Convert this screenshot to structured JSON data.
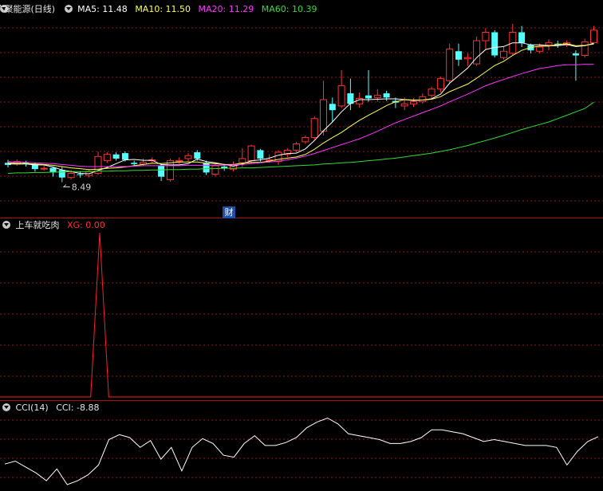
{
  "header": {
    "title": "广聚能源(日线)",
    "ma5": "MA5: 11.48",
    "ma10": "MA10: 11.50",
    "ma20": "MA20: 11.29",
    "ma60": "MA60: 10.39"
  },
  "panel2": {
    "title": "上车就吃肉",
    "xg": "XG: 0.00"
  },
  "panel3": {
    "title": "CCI(14)",
    "cci": "CCI: -8.88"
  },
  "annotations": {
    "low_price": "8.49",
    "cai_badge": "财"
  },
  "colors": {
    "up": "#ff3232",
    "down": "#54ffff",
    "ma5": "#ffffff",
    "ma10": "#ffff55",
    "ma20": "#ff33ff",
    "ma60": "#33dd33",
    "grid": "#8a1a1a",
    "signal": "#ff2020",
    "cci": "#ffffff"
  },
  "chart_data": [
    {
      "type": "candlestick",
      "y_unit": "price",
      "ylim": [
        7.8,
        12.4
      ],
      "candles": [
        {
          "o": 8.95,
          "c": 8.9,
          "h": 9.02,
          "l": 8.84
        },
        {
          "o": 8.92,
          "c": 8.98,
          "h": 9.03,
          "l": 8.88
        },
        {
          "o": 8.96,
          "c": 8.93,
          "h": 9.0,
          "l": 8.86
        },
        {
          "o": 8.92,
          "c": 8.8,
          "h": 8.96,
          "l": 8.74
        },
        {
          "o": 8.8,
          "c": 8.82,
          "h": 8.9,
          "l": 8.76
        },
        {
          "o": 8.83,
          "c": 8.72,
          "h": 8.86,
          "l": 8.62
        },
        {
          "o": 8.78,
          "c": 8.6,
          "h": 8.85,
          "l": 8.49
        },
        {
          "o": 8.6,
          "c": 8.7,
          "h": 8.78,
          "l": 8.55
        },
        {
          "o": 8.68,
          "c": 8.66,
          "h": 8.75,
          "l": 8.6
        },
        {
          "o": 8.65,
          "c": 8.75,
          "h": 8.8,
          "l": 8.6
        },
        {
          "o": 8.7,
          "c": 9.1,
          "h": 9.22,
          "l": 8.66
        },
        {
          "o": 9.0,
          "c": 9.15,
          "h": 9.2,
          "l": 8.95
        },
        {
          "o": 9.15,
          "c": 9.05,
          "h": 9.2,
          "l": 9.0
        },
        {
          "o": 9.18,
          "c": 9.02,
          "h": 9.22,
          "l": 8.98
        },
        {
          "o": 8.95,
          "c": 8.92,
          "h": 9.0,
          "l": 8.86
        },
        {
          "o": 8.92,
          "c": 8.96,
          "h": 9.05,
          "l": 8.88
        },
        {
          "o": 9.0,
          "c": 9.02,
          "h": 9.08,
          "l": 8.95
        },
        {
          "o": 8.88,
          "c": 8.62,
          "h": 8.92,
          "l": 8.52
        },
        {
          "o": 8.55,
          "c": 9.0,
          "h": 9.05,
          "l": 8.5
        },
        {
          "o": 8.98,
          "c": 9.0,
          "h": 9.08,
          "l": 8.92
        },
        {
          "o": 9.05,
          "c": 9.12,
          "h": 9.18,
          "l": 8.98
        },
        {
          "o": 9.2,
          "c": 9.05,
          "h": 9.25,
          "l": 9.0
        },
        {
          "o": 8.95,
          "c": 8.72,
          "h": 9.0,
          "l": 8.66
        },
        {
          "o": 8.68,
          "c": 8.88,
          "h": 8.95,
          "l": 8.62
        },
        {
          "o": 8.86,
          "c": 8.82,
          "h": 8.92,
          "l": 8.76
        },
        {
          "o": 8.8,
          "c": 8.9,
          "h": 8.98,
          "l": 8.75
        },
        {
          "o": 8.95,
          "c": 9.05,
          "h": 9.3,
          "l": 8.85
        },
        {
          "o": 9.0,
          "c": 9.35,
          "h": 9.38,
          "l": 8.94
        },
        {
          "o": 9.25,
          "c": 9.05,
          "h": 9.28,
          "l": 8.98
        },
        {
          "o": 9.0,
          "c": 9.02,
          "h": 9.15,
          "l": 8.95
        },
        {
          "o": 8.98,
          "c": 9.2,
          "h": 9.25,
          "l": 8.9
        },
        {
          "o": 9.15,
          "c": 9.25,
          "h": 9.3,
          "l": 9.08
        },
        {
          "o": 9.25,
          "c": 9.4,
          "h": 9.45,
          "l": 9.2
        },
        {
          "o": 9.45,
          "c": 9.55,
          "h": 9.6,
          "l": 9.4
        },
        {
          "o": 9.55,
          "c": 10.0,
          "h": 10.05,
          "l": 9.5
        },
        {
          "o": 9.7,
          "c": 10.45,
          "h": 10.9,
          "l": 9.6
        },
        {
          "o": 10.35,
          "c": 10.2,
          "h": 10.5,
          "l": 9.92
        },
        {
          "o": 10.3,
          "c": 10.78,
          "h": 11.15,
          "l": 10.25
        },
        {
          "o": 10.6,
          "c": 10.35,
          "h": 10.95,
          "l": 10.2
        },
        {
          "o": 10.35,
          "c": 10.48,
          "h": 10.62,
          "l": 10.26
        },
        {
          "o": 10.55,
          "c": 10.48,
          "h": 11.15,
          "l": 10.4
        },
        {
          "o": 10.5,
          "c": 10.55,
          "h": 10.7,
          "l": 10.4
        },
        {
          "o": 10.6,
          "c": 10.5,
          "h": 10.66,
          "l": 10.42
        },
        {
          "o": 10.42,
          "c": 10.38,
          "h": 10.5,
          "l": 10.25
        },
        {
          "o": 10.3,
          "c": 10.35,
          "h": 10.5,
          "l": 10.2
        },
        {
          "o": 10.35,
          "c": 10.4,
          "h": 10.48,
          "l": 10.28
        },
        {
          "o": 10.4,
          "c": 10.52,
          "h": 10.6,
          "l": 10.35
        },
        {
          "o": 10.55,
          "c": 10.7,
          "h": 10.76,
          "l": 10.48
        },
        {
          "o": 10.7,
          "c": 10.95,
          "h": 11.0,
          "l": 10.62
        },
        {
          "o": 10.9,
          "c": 11.65,
          "h": 11.78,
          "l": 10.85
        },
        {
          "o": 11.6,
          "c": 11.4,
          "h": 11.78,
          "l": 11.25
        },
        {
          "o": 11.42,
          "c": 11.45,
          "h": 11.55,
          "l": 11.25
        },
        {
          "o": 11.3,
          "c": 11.85,
          "h": 11.95,
          "l": 11.25
        },
        {
          "o": 11.85,
          "c": 12.05,
          "h": 12.15,
          "l": 11.65
        },
        {
          "o": 12.05,
          "c": 11.5,
          "h": 12.1,
          "l": 11.45
        },
        {
          "o": 11.45,
          "c": 11.6,
          "h": 11.7,
          "l": 11.4
        },
        {
          "o": 11.55,
          "c": 12.05,
          "h": 12.25,
          "l": 11.5
        },
        {
          "o": 12.05,
          "c": 11.8,
          "h": 12.2,
          "l": 11.7
        },
        {
          "o": 11.75,
          "c": 11.62,
          "h": 11.78,
          "l": 11.55
        },
        {
          "o": 11.6,
          "c": 11.7,
          "h": 11.78,
          "l": 11.55
        },
        {
          "o": 11.75,
          "c": 11.8,
          "h": 11.88,
          "l": 11.62
        },
        {
          "o": 11.78,
          "c": 11.75,
          "h": 11.85,
          "l": 11.68
        },
        {
          "o": 11.75,
          "c": 11.8,
          "h": 11.86,
          "l": 11.7
        },
        {
          "o": 11.55,
          "c": 11.5,
          "h": 11.62,
          "l": 10.9
        },
        {
          "o": 11.5,
          "c": 11.82,
          "h": 11.9,
          "l": 11.45
        },
        {
          "o": 11.8,
          "c": 12.1,
          "h": 12.2,
          "l": 11.78
        }
      ],
      "ma_series": [
        {
          "name": "MA5",
          "values": [
            8.92,
            8.92,
            8.92,
            8.9,
            8.9,
            8.85,
            8.78,
            8.74,
            8.7,
            8.69,
            8.77,
            8.84,
            8.93,
            9.02,
            9.03,
            9.01,
            9.01,
            8.91,
            8.9,
            8.9,
            8.93,
            9.04,
            8.98,
            8.95,
            8.91,
            8.87,
            8.92,
            9.0,
            9.02,
            9.06,
            9.13,
            9.17,
            9.18,
            9.28,
            9.48,
            9.71,
            9.92,
            10.16,
            10.36,
            10.45,
            10.45,
            10.46,
            10.47,
            10.47,
            10.45,
            10.43,
            10.44,
            10.47,
            10.58,
            10.84,
            11.02,
            11.2,
            11.45,
            11.64,
            11.69,
            11.71,
            11.8,
            11.8,
            11.75,
            11.75,
            11.73,
            11.73,
            11.76,
            11.71,
            11.73,
            11.79
          ]
        },
        {
          "name": "MA10",
          "values": [
            8.95,
            8.94,
            8.93,
            8.92,
            8.91,
            8.89,
            8.86,
            8.83,
            8.81,
            8.79,
            8.8,
            8.82,
            8.83,
            8.85,
            8.88,
            8.91,
            8.94,
            8.93,
            8.95,
            8.97,
            8.97,
            8.97,
            8.94,
            8.93,
            8.91,
            8.91,
            8.94,
            8.96,
            8.96,
            8.99,
            9.03,
            9.06,
            9.09,
            9.15,
            9.27,
            9.42,
            9.55,
            9.67,
            9.82,
            9.96,
            10.08,
            10.19,
            10.31,
            10.4,
            10.45,
            10.44,
            10.44,
            10.46,
            10.52,
            10.64,
            10.73,
            10.82,
            10.96,
            11.11,
            11.26,
            11.36,
            11.5,
            11.62,
            11.69,
            11.72,
            11.72,
            11.76,
            11.78,
            11.73,
            11.74,
            11.77
          ]
        },
        {
          "name": "MA20",
          "values": [
            8.98,
            8.97,
            8.96,
            8.95,
            8.94,
            8.93,
            8.91,
            8.89,
            8.87,
            8.86,
            8.86,
            8.86,
            8.86,
            8.86,
            8.87,
            8.88,
            8.88,
            8.88,
            8.88,
            8.88,
            8.89,
            8.89,
            8.89,
            8.89,
            8.89,
            8.9,
            8.91,
            8.93,
            8.95,
            8.97,
            8.99,
            9.02,
            9.06,
            9.11,
            9.17,
            9.24,
            9.31,
            9.38,
            9.45,
            9.52,
            9.61,
            9.7,
            9.8,
            9.9,
            9.98,
            10.06,
            10.14,
            10.22,
            10.3,
            10.4,
            10.49,
            10.58,
            10.68,
            10.78,
            10.86,
            10.93,
            11.0,
            11.07,
            11.13,
            11.19,
            11.22,
            11.26,
            11.28,
            11.28,
            11.29,
            11.29
          ]
        },
        {
          "name": "MA60",
          "values": [
            8.7,
            8.71,
            8.71,
            8.72,
            8.72,
            8.73,
            8.73,
            8.74,
            8.74,
            8.74,
            8.75,
            8.75,
            8.76,
            8.76,
            8.77,
            8.77,
            8.78,
            8.78,
            8.79,
            8.79,
            8.8,
            8.8,
            8.81,
            8.81,
            8.82,
            8.82,
            8.83,
            8.83,
            8.84,
            8.85,
            8.86,
            8.87,
            8.88,
            8.89,
            8.9,
            8.92,
            8.93,
            8.95,
            8.96,
            8.98,
            9.0,
            9.02,
            9.04,
            9.06,
            9.09,
            9.12,
            9.15,
            9.18,
            9.22,
            9.26,
            9.31,
            9.36,
            9.42,
            9.48,
            9.54,
            9.6,
            9.67,
            9.74,
            9.8,
            9.86,
            9.92,
            10.0,
            10.08,
            10.16,
            10.24,
            10.39
          ]
        }
      ]
    },
    {
      "type": "line",
      "name": "XG",
      "ylim": [
        0,
        1
      ],
      "values": [
        0,
        0,
        0,
        0,
        0,
        0,
        0,
        0,
        0,
        0,
        1,
        0,
        0,
        0,
        0,
        0,
        0,
        0,
        0,
        0,
        0,
        0,
        0,
        0,
        0,
        0,
        0,
        0,
        0,
        0,
        0,
        0,
        0,
        0,
        0,
        0,
        0,
        0,
        0,
        0,
        0,
        0,
        0,
        0,
        0,
        0,
        0,
        0,
        0,
        0,
        0,
        0,
        0,
        0,
        0,
        0,
        0,
        0,
        0,
        0,
        0,
        0,
        0,
        0,
        0,
        0
      ]
    },
    {
      "type": "line",
      "name": "CCI",
      "ylim": [
        -200,
        150
      ],
      "values": [
        -95,
        -80,
        -110,
        -140,
        -180,
        -120,
        -200,
        -180,
        -150,
        -100,
        30,
        55,
        40,
        -10,
        25,
        -70,
        -10,
        -130,
        -10,
        35,
        10,
        -50,
        -60,
        10,
        50,
        0,
        0,
        15,
        40,
        90,
        120,
        140,
        110,
        60,
        50,
        40,
        30,
        10,
        10,
        20,
        40,
        80,
        80,
        70,
        60,
        40,
        20,
        30,
        20,
        10,
        0,
        0,
        0,
        -10,
        -100,
        -30,
        20,
        45
      ]
    }
  ]
}
